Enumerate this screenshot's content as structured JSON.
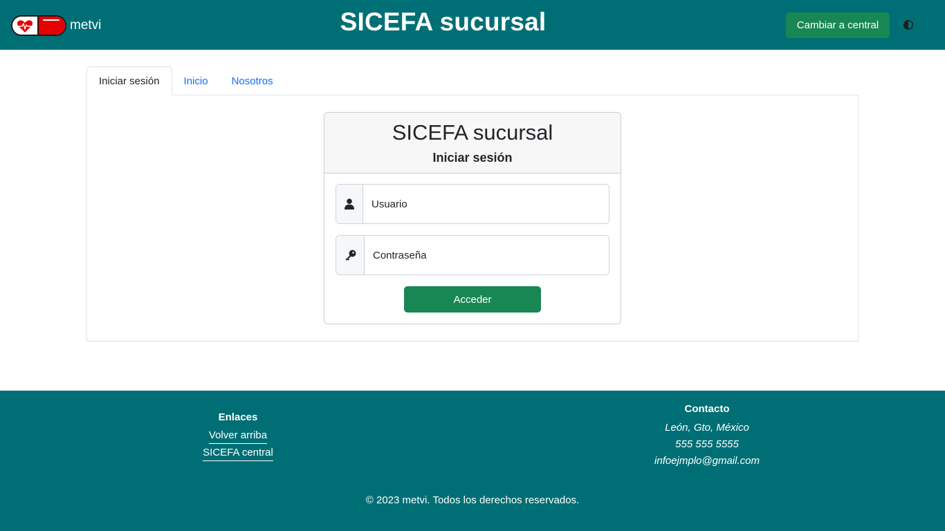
{
  "header": {
    "brand_name": "metvi",
    "title": "SICEFA sucursal",
    "switch_button": "Cambiar a central",
    "theme_toggle_icon": "contrast-icon",
    "colors": {
      "bar": "#006f75",
      "button": "#198754"
    }
  },
  "tabs": [
    {
      "label": "Iniciar sesión",
      "active": true
    },
    {
      "label": "Inicio",
      "active": false
    },
    {
      "label": "Nosotros",
      "active": false
    }
  ],
  "login": {
    "title": "SICEFA sucursal",
    "subtitle": "Iniciar sesión",
    "username": {
      "placeholder": "Usuario",
      "value": "",
      "icon": "user-icon"
    },
    "password": {
      "placeholder": "Contraseña",
      "value": "",
      "icon": "key-icon"
    },
    "submit_label": "Acceder"
  },
  "footer": {
    "links_heading": "Enlaces",
    "links": [
      "Volver arriba",
      "SICEFA central"
    ],
    "contact_heading": "Contacto",
    "contact": [
      "León, Gto, México",
      "555 555 5555",
      "infoejmplo@gmail.com"
    ],
    "copyright": "© 2023 metvi. Todos los derechos reservados."
  }
}
